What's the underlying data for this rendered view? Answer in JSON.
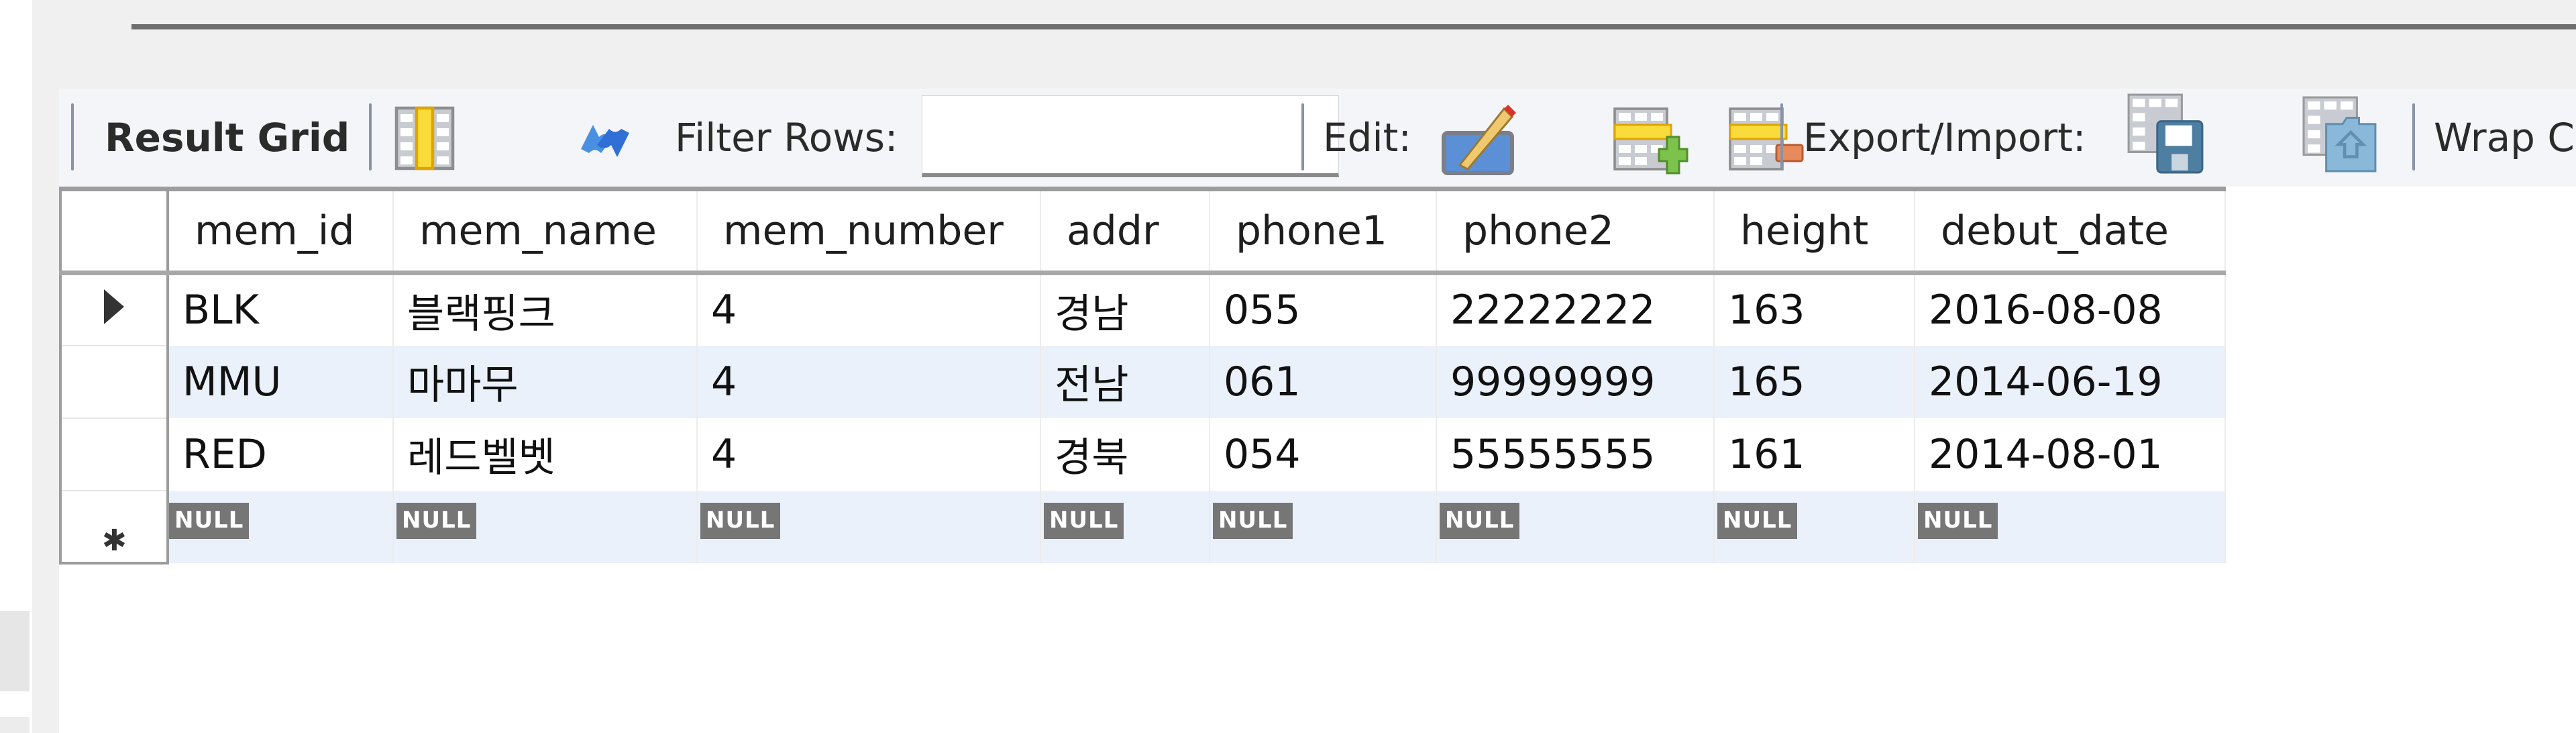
{
  "toolbar": {
    "result_grid_label": "Result Grid",
    "filter_rows_label": "Filter Rows:",
    "filter_rows_value": "",
    "edit_label": "Edit:",
    "export_import_label": "Export/Import:",
    "wrap_cell_label": "Wrap Cell",
    "icons": {
      "grid_form_toggle": "column-grid-icon",
      "refresh": "refresh-icon",
      "edit_row": "edit-pencil-icon",
      "insert_row": "insert-row-icon",
      "delete_row": "delete-row-icon",
      "export": "export-save-icon",
      "import": "import-folder-icon"
    }
  },
  "grid": {
    "columns": [
      "mem_id",
      "mem_name",
      "mem_number",
      "addr",
      "phone1",
      "phone2",
      "height",
      "debut_date"
    ],
    "rows": [
      [
        "BLK",
        "블랙핑크",
        "4",
        "경남",
        "055",
        "22222222",
        "163",
        "2016-08-08"
      ],
      [
        "MMU",
        "마마무",
        "4",
        "전남",
        "061",
        "99999999",
        "165",
        "2014-06-19"
      ],
      [
        "RED",
        "레드벨벳",
        "4",
        "경북",
        "054",
        "55555555",
        "161",
        "2014-08-01"
      ]
    ],
    "new_row": [
      "NULL",
      "NULL",
      "NULL",
      "NULL",
      "NULL",
      "NULL",
      "NULL",
      "NULL"
    ],
    "current_row_marker": "▶",
    "new_row_marker": "✱"
  }
}
